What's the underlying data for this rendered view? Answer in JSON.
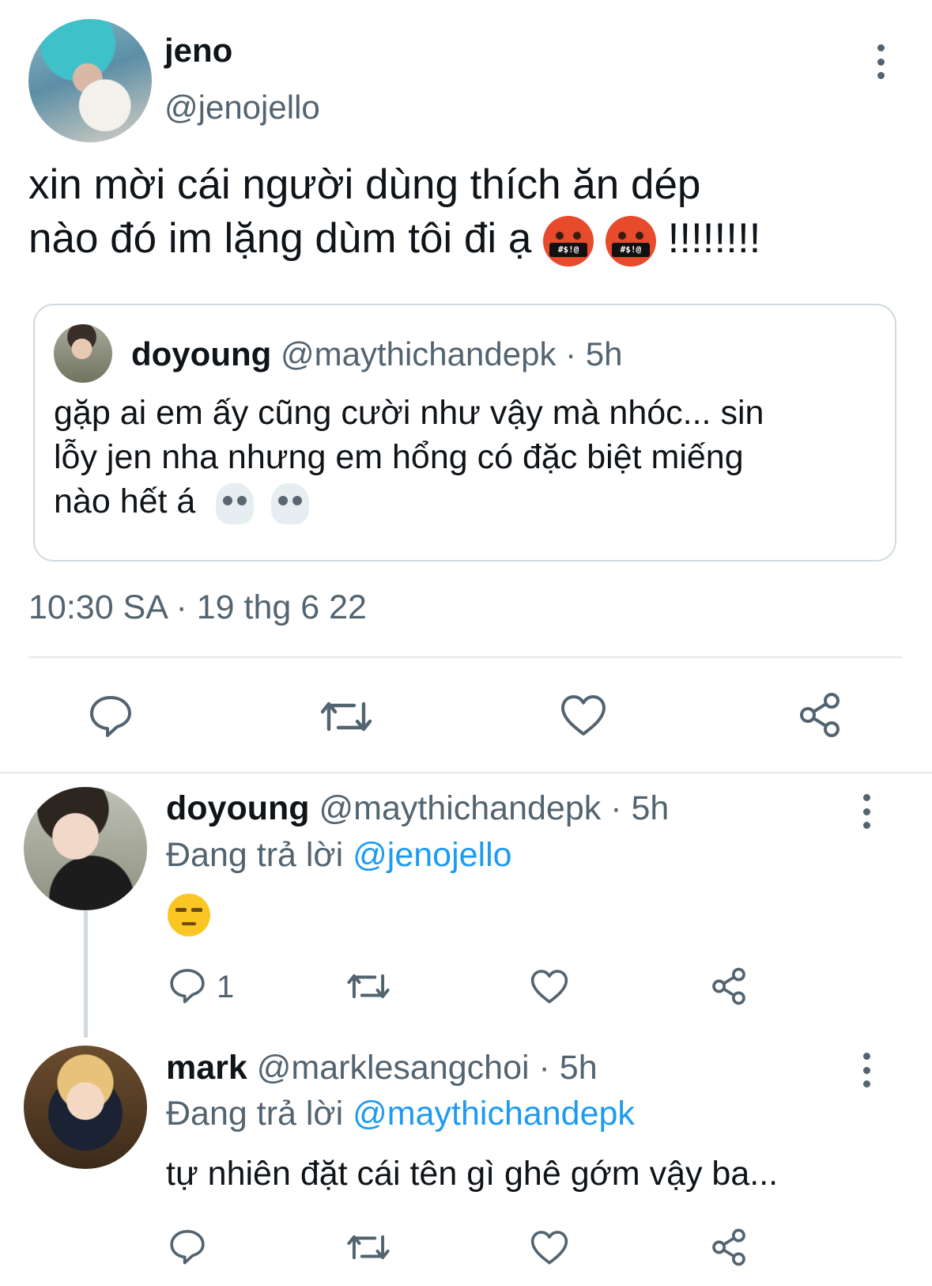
{
  "main_tweet": {
    "display_name": "jeno",
    "handle": "@jenojello",
    "text_line1": "xin mời cái người dùng thích ăn dép",
    "text_line2": "nào đó im lặng dùm tôi đi ạ",
    "text_suffix": "!!!!!!!!",
    "emoji_symbols": "#$!@",
    "timestamp": "10:30 SA · 19 thg 6 22",
    "quoted": {
      "display_name": "doyoung",
      "handle": "@maythichandepk",
      "time": "· 5h",
      "text_line1": "gặp ai em ấy cũng cười như vậy mà nhóc... sin",
      "text_line2": "lỗy jen nha nhưng em hổng có đặc biệt miếng",
      "text_line3": "nào hết á"
    },
    "actions": [
      "reply-icon",
      "retweet-icon",
      "like-icon",
      "share-icon"
    ]
  },
  "replies": [
    {
      "display_name": "doyoung",
      "handle": "@maythichandepk",
      "time": "· 5h",
      "replying_prefix": "Đang trả lời",
      "replying_to": "@jenojello",
      "reply_count": "1"
    },
    {
      "display_name": "mark",
      "handle": "@marklesangchoi",
      "time": "· 5h",
      "replying_prefix": "Đang trả lời",
      "replying_to": "@maythichandepk",
      "text": "tự nhiên đặt cái tên gì ghê gớm vậy ba..."
    }
  ],
  "colors": {
    "text": "#0f1419",
    "secondary": "#536471",
    "link": "#1d9bf0",
    "border": "#cfd9de"
  }
}
